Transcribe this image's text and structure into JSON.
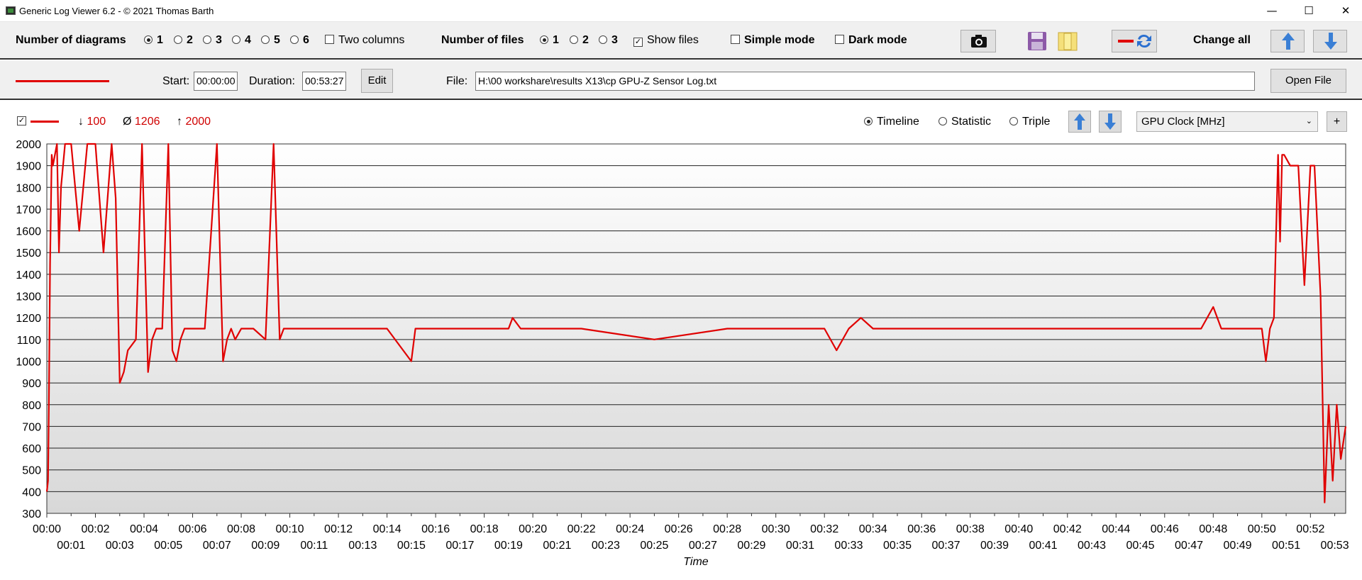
{
  "window": {
    "title": "Generic Log Viewer 6.2 - © 2021 Thomas Barth",
    "minimize": "—",
    "maximize": "☐",
    "close": "✕"
  },
  "toolbar": {
    "diagrams_label": "Number of diagrams",
    "diagram_options": [
      "1",
      "2",
      "3",
      "4",
      "5",
      "6"
    ],
    "diagrams_selected": "1",
    "two_columns": "Two columns",
    "files_label": "Number of files",
    "file_options": [
      "1",
      "2",
      "3"
    ],
    "files_selected": "1",
    "show_files": "Show files",
    "show_files_checked": true,
    "simple_mode": "Simple mode",
    "dark_mode": "Dark mode",
    "change_all": "Change all"
  },
  "file_row": {
    "start_label": "Start:",
    "start_value": "00:00:00",
    "duration_label": "Duration:",
    "duration_value": "00:53:27",
    "edit": "Edit",
    "file_label": "File:",
    "file_path": "H:\\00 workshare\\results X13\\cp GPU-Z Sensor Log.txt",
    "open_file": "Open File"
  },
  "diagram": {
    "legend_checked": true,
    "min_symbol": "↓",
    "min_value": "100",
    "avg_symbol": "Ø",
    "avg_value": "1206",
    "max_symbol": "↑",
    "max_value": "2000",
    "modes": [
      "Timeline",
      "Statistic",
      "Triple"
    ],
    "mode_selected": "Timeline",
    "sensor": "GPU Clock [MHz]",
    "add": "+",
    "xlabel": "Time"
  },
  "colors": {
    "series": "#e00000",
    "accent_blue": "#3a7fd5"
  },
  "chart_data": {
    "type": "line",
    "title": "",
    "xlabel": "Time",
    "ylabel": "",
    "series": [
      {
        "x": [
          "00:00:00",
          "00:00:03",
          "00:00:05",
          "00:00:08",
          "00:00:12",
          "00:00:15",
          "00:00:20",
          "00:00:25",
          "00:00:30",
          "00:00:35",
          "00:00:45",
          "00:01:00",
          "00:01:20",
          "00:01:40",
          "00:02:00",
          "00:02:20",
          "00:02:40",
          "00:02:50",
          "00:03:00",
          "00:03:10",
          "00:03:20",
          "00:03:40",
          "00:03:55",
          "00:04:10",
          "00:04:20",
          "00:04:30",
          "00:04:45",
          "00:05:00",
          "00:05:10",
          "00:05:20",
          "00:05:30",
          "00:05:40",
          "00:05:50",
          "00:06:10",
          "00:06:30",
          "00:07:00",
          "00:07:15",
          "00:07:25",
          "00:07:35",
          "00:07:45",
          "00:08:00",
          "00:08:30",
          "00:09:00",
          "00:09:20",
          "00:09:35",
          "00:09:45",
          "00:10:00",
          "00:12:00",
          "00:14:00",
          "00:15:00",
          "00:15:10",
          "00:16:00",
          "00:19:00",
          "00:19:10",
          "00:19:30",
          "00:22:00",
          "00:25:00",
          "00:28:00",
          "00:32:00",
          "00:32:30",
          "00:33:00",
          "00:33:30",
          "00:34:00",
          "00:38:00",
          "00:42:00",
          "00:46:00",
          "00:47:30",
          "00:48:00",
          "00:48:20",
          "00:50:00",
          "00:50:10",
          "00:50:20",
          "00:50:30",
          "00:50:40",
          "00:50:45",
          "00:50:50",
          "00:50:55",
          "00:51:10",
          "00:51:30",
          "00:51:45",
          "00:52:00",
          "00:52:10",
          "00:52:25",
          "00:52:35",
          "00:52:45",
          "00:52:55",
          "00:53:05",
          "00:53:15",
          "00:53:27"
        ],
        "y": [
          400,
          450,
          800,
          1450,
          1950,
          1900,
          1950,
          2000,
          1500,
          1800,
          2000,
          2000,
          1600,
          2000,
          2000,
          1500,
          2000,
          1750,
          900,
          950,
          1050,
          1100,
          2000,
          950,
          1100,
          1150,
          1150,
          2000,
          1050,
          1000,
          1100,
          1150,
          1150,
          1150,
          1150,
          2000,
          1000,
          1100,
          1150,
          1100,
          1150,
          1150,
          1100,
          2000,
          1100,
          1150,
          1150,
          1150,
          1150,
          1000,
          1150,
          1150,
          1150,
          1200,
          1150,
          1150,
          1100,
          1150,
          1150,
          1050,
          1150,
          1200,
          1150,
          1150,
          1150,
          1150,
          1150,
          1250,
          1150,
          1150,
          1000,
          1150,
          1200,
          1950,
          1550,
          1950,
          1950,
          1900,
          1900,
          1350,
          1900,
          1900,
          1300,
          350,
          800,
          450,
          800,
          550,
          700
        ]
      }
    ],
    "xlim": [
      "00:00:00",
      "00:53:27"
    ],
    "xticks_top": [
      "00:00",
      "00:02",
      "00:04",
      "00:06",
      "00:08",
      "00:10",
      "00:12",
      "00:14",
      "00:16",
      "00:18",
      "00:20",
      "00:22",
      "00:24",
      "00:26",
      "00:28",
      "00:30",
      "00:32",
      "00:34",
      "00:36",
      "00:38",
      "00:40",
      "00:42",
      "00:44",
      "00:46",
      "00:48",
      "00:50",
      "00:52"
    ],
    "xticks_bottom": [
      "00:01",
      "00:03",
      "00:05",
      "00:07",
      "00:09",
      "00:11",
      "00:13",
      "00:15",
      "00:17",
      "00:19",
      "00:21",
      "00:23",
      "00:25",
      "00:27",
      "00:29",
      "00:31",
      "00:33",
      "00:35",
      "00:37",
      "00:39",
      "00:41",
      "00:43",
      "00:45",
      "00:47",
      "00:49",
      "00:51",
      "00:53"
    ],
    "ylim": [
      300,
      2000
    ],
    "yticks": [
      300,
      400,
      500,
      600,
      700,
      800,
      900,
      1000,
      1100,
      1200,
      1300,
      1400,
      1500,
      1600,
      1700,
      1800,
      1900,
      2000
    ],
    "grid": true,
    "legend": "top-left"
  }
}
